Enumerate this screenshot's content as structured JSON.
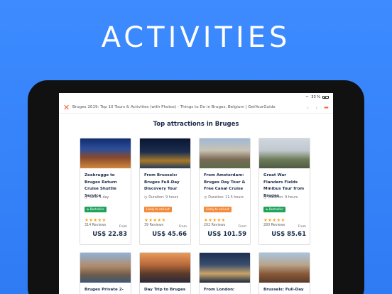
{
  "hero": {
    "title": "ACTIVITIES"
  },
  "status": {
    "battery": "33 %"
  },
  "browser": {
    "page_title": "Bruges 2019: Top 10 Tours & Activities (with Photos) - Things to Do in Bruges, Belgium | GetYourGuide",
    "close_icon": "close-icon",
    "back_icon": "chevron-left-icon",
    "forward_icon": "chevron-right-icon",
    "share_icon": "share-icon"
  },
  "section": {
    "title": "Top attractions in Bruges"
  },
  "cards": [
    {
      "title": "Zeebrugge to Bruges Return Cruise Shuttle Service",
      "meta": "Valid: 1 day",
      "badge": "★ Bestseller",
      "badge_color": "#1fa35b",
      "stars": "★★★★★",
      "rating": 4.5,
      "reviews": "314 Reviews",
      "from": "From",
      "price": "US$ 22.83"
    },
    {
      "title": "From Brussels: Bruges Full-Day Discovery Tour",
      "meta": "Duration: 9 hours",
      "badge": "Likely to sell out",
      "badge_color": "#f58a3b",
      "stars": "★★★★★",
      "rating": 4.5,
      "reviews": "39 Reviews",
      "from": "From",
      "price": "US$ 45.66"
    },
    {
      "title": "From Amsterdam: Bruges Day Tour & Free Canal Cruise",
      "meta": "Duration: 11.5 hours",
      "badge": "Likely to sell out",
      "badge_color": "#f58a3b",
      "stars": "★★★★★",
      "rating": 4.5,
      "reviews": "202 Reviews",
      "from": "From",
      "price": "US$ 101.59"
    },
    {
      "title": "Great War Flanders Fields Minibus Tour from Bruges",
      "meta": "Duration: 9 hours",
      "badge": "★ Bestseller",
      "badge_color": "#1fa35b",
      "stars": "★★★★★",
      "rating": 5,
      "reviews": "280 Reviews",
      "from": "From",
      "price": "US$ 85.61"
    }
  ],
  "cards_row2": [
    {
      "title": "Bruges Private 2-Hour"
    },
    {
      "title": "Day Trip to Bruges"
    },
    {
      "title": "From London: Bruges"
    },
    {
      "title": "Brussels: Full-Day Trip"
    }
  ]
}
